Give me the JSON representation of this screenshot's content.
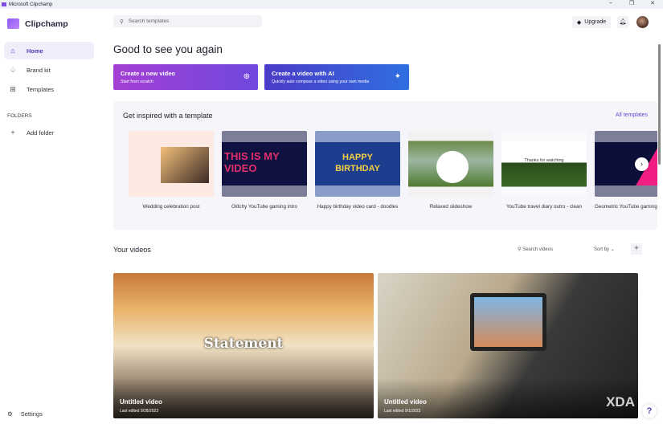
{
  "window": {
    "title": "Microsoft Clipchamp",
    "controls": [
      "–",
      "❐",
      "✕"
    ]
  },
  "sidebar": {
    "brand": "Clipchamp",
    "items": [
      {
        "label": "Home",
        "icon": "⌂"
      },
      {
        "label": "Brand kit",
        "icon": "♤"
      },
      {
        "label": "Templates",
        "icon": "⊞"
      }
    ],
    "folders_heading": "FOLDERS",
    "add_folder": "Add folder",
    "settings": "Settings"
  },
  "header": {
    "search_placeholder": "Search templates",
    "upgrade": "Upgrade"
  },
  "main": {
    "greeting": "Good to see you again",
    "cta": [
      {
        "title": "Create a new video",
        "subtitle": "Start from scratch"
      },
      {
        "title": "Create a video with AI",
        "subtitle": "Quickly auto compose a video using your own media"
      }
    ],
    "templates": {
      "heading": "Get inspired with a template",
      "all_link": "All templates",
      "items": [
        "Wedding celebration post",
        "Glitchy YouTube gaming intro",
        "Happy birthday video card - doodles",
        "Relaxed slideshow",
        "YouTube travel diary outro - clean",
        "Geometric YouTube gaming"
      ],
      "thumb_text": {
        "glitch": "THIS IS MY VIDEO",
        "birthday": "HAPPY BIRTHDAY",
        "outro": "Thanks for watching"
      }
    },
    "videos": {
      "heading": "Your videos",
      "search_placeholder": "Search videos",
      "sort": "Sort by",
      "items": [
        {
          "title": "Untitled video",
          "edited": "Last edited 9/28/2023",
          "overlay": "Statement"
        },
        {
          "title": "Untitled video",
          "edited": "Last edited 9/1/2023",
          "overlay": "XDA"
        }
      ]
    }
  },
  "help": "?"
}
